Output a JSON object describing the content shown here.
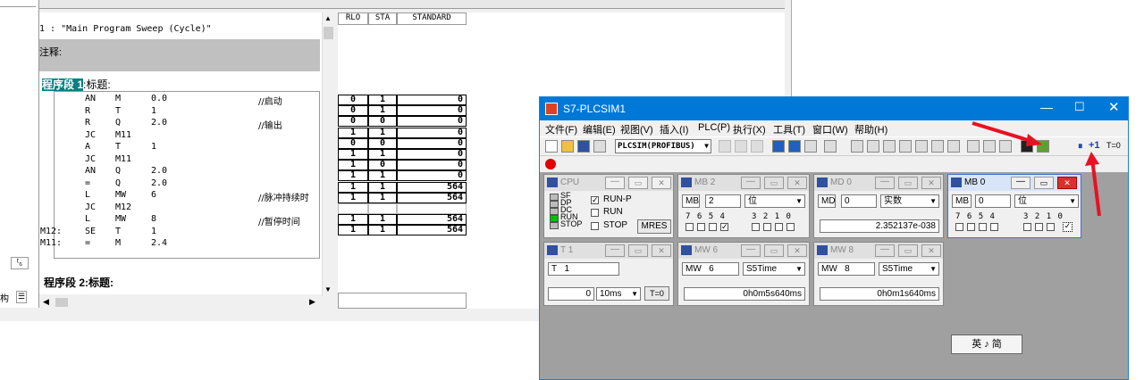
{
  "editor": {
    "network1_title": "1 :  \"Main Program Sweep (Cycle)\"",
    "comment_label": "注释:",
    "segment1_highlight": "程序段 1",
    "segment1_suffix": ":标题:",
    "segment2_label": "程序段 2:标题:",
    "code": [
      {
        "label": "",
        "op": "AN",
        "operand": "M",
        "addr": "0.0",
        "comment": "//启动"
      },
      {
        "label": "",
        "op": "R",
        "operand": "T",
        "addr": "1",
        "comment": ""
      },
      {
        "label": "",
        "op": "R",
        "operand": "Q",
        "addr": "2.0",
        "comment": "//输出"
      },
      {
        "label": "",
        "op": "JC",
        "operand": "M11",
        "addr": "",
        "comment": ""
      },
      {
        "label": "",
        "op": "A",
        "operand": "T",
        "addr": "1",
        "comment": ""
      },
      {
        "label": "",
        "op": "JC",
        "operand": "M11",
        "addr": "",
        "comment": ""
      },
      {
        "label": "",
        "op": "AN",
        "operand": "Q",
        "addr": "2.0",
        "comment": ""
      },
      {
        "label": "",
        "op": "=",
        "operand": "Q",
        "addr": "2.0",
        "comment": ""
      },
      {
        "label": "",
        "op": "L",
        "operand": "MW",
        "addr": "6",
        "comment": "//脉冲持续时"
      },
      {
        "label": "",
        "op": "JC",
        "operand": "M12",
        "addr": "",
        "comment": ""
      },
      {
        "label": "",
        "op": "L",
        "operand": "MW",
        "addr": "8",
        "comment": "//暂停时间"
      },
      {
        "label": "M12:",
        "op": "SE",
        "operand": "T",
        "addr": "1",
        "comment": ""
      },
      {
        "label": "M11:",
        "op": "=",
        "operand": "M",
        "addr": "2.4",
        "comment": ""
      }
    ],
    "status_headers": [
      "RLO",
      "STA",
      "STANDARD"
    ],
    "status_rows": [
      [
        "0",
        "1",
        "0"
      ],
      [
        "0",
        "1",
        "0"
      ],
      [
        "0",
        "0",
        "0"
      ],
      [
        "1",
        "1",
        "0"
      ],
      [
        "0",
        "0",
        "0"
      ],
      [
        "1",
        "1",
        "0"
      ],
      [
        "1",
        "0",
        "0"
      ],
      [
        "1",
        "1",
        "0"
      ],
      [
        "1",
        "1",
        "564"
      ],
      [
        "1",
        "1",
        "564"
      ],
      [
        "",
        "",
        ""
      ],
      [
        "1",
        "1",
        "564"
      ],
      [
        "1",
        "1",
        "564"
      ]
    ],
    "left_strip_labels": [
      "ᵗ₆",
      "构"
    ]
  },
  "plcsim": {
    "title": "S7-PLCSIM1",
    "menu": [
      "文件(F)",
      "编辑(E)",
      "视图(V)",
      "插入(I)",
      "PLC(P)",
      "执行(X)",
      "工具(T)",
      "窗口(W)",
      "帮助(H)"
    ],
    "interface_select": "PLCSIM(PROFIBUS)",
    "step_label": "+1",
    "timer_label": "T=0",
    "cpu": {
      "title": "CPU",
      "leds": [
        "SF",
        "DP",
        "DC",
        "RUN",
        "STOP"
      ],
      "modes": [
        "RUN-P",
        "RUN",
        "STOP"
      ],
      "mres": "MRES"
    },
    "mb2": {
      "title": "MB   2",
      "type": "MB",
      "addr": "2",
      "format": "位",
      "bits": [
        "7",
        "6",
        "5",
        "4",
        "3",
        "2",
        "1",
        "0"
      ]
    },
    "md0": {
      "title": "MD   0",
      "type": "MD",
      "addr": "0",
      "format": "实数",
      "value": "2.352137e-038"
    },
    "mb0": {
      "title": "MB   0",
      "type": "MB",
      "addr": "0",
      "format": "位",
      "bits": [
        "7",
        "6",
        "5",
        "4",
        "3",
        "2",
        "1",
        "0"
      ]
    },
    "t1": {
      "title": "T   1",
      "type": "T",
      "addr": "1",
      "value": "0",
      "base": "10ms",
      "reset": "T=0"
    },
    "mw6": {
      "title": "MW   6",
      "type": "MW",
      "addr": "6",
      "format": "S5Time",
      "value": "0h0m5s640ms"
    },
    "mw8": {
      "title": "MW   8",
      "type": "MW",
      "addr": "8",
      "format": "S5Time",
      "value": "0h0m1s640ms"
    },
    "ime": "英 ♪ 简"
  },
  "colors": {
    "accent": "#0078d7",
    "highlight": "#008080",
    "arrow": "#e81123",
    "led_green": "#00c000"
  }
}
